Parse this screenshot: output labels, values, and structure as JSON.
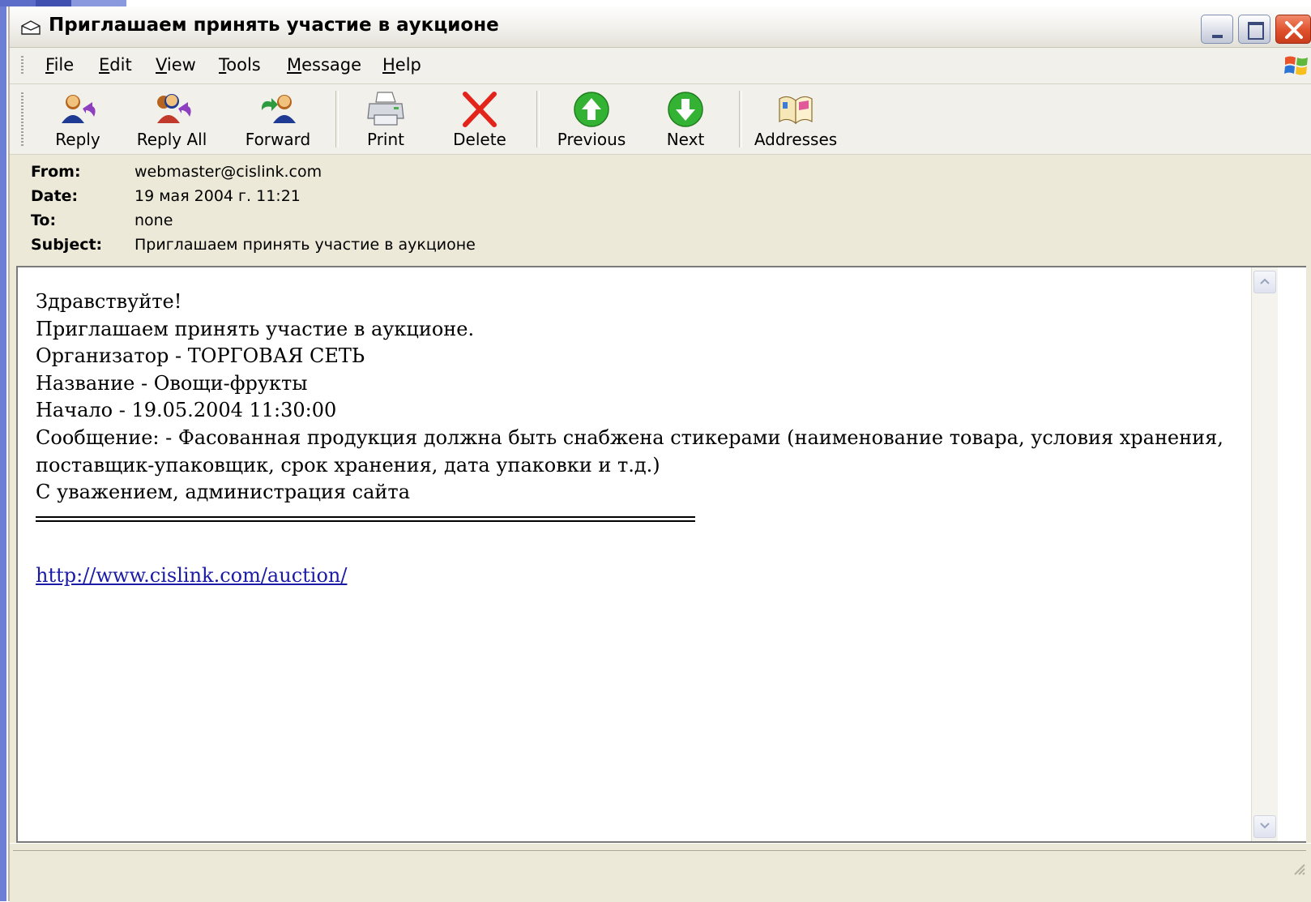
{
  "window": {
    "title": "Приглашаем принять участие в аукционе"
  },
  "menu": {
    "items": [
      {
        "underline": "F",
        "rest": "ile"
      },
      {
        "underline": "E",
        "rest": "dit"
      },
      {
        "underline": "V",
        "rest": "iew"
      },
      {
        "underline": "T",
        "rest": "ools"
      },
      {
        "underline": "M",
        "rest": "essage"
      },
      {
        "underline": "H",
        "rest": "elp"
      }
    ]
  },
  "toolbar": {
    "reply": {
      "label": "Reply",
      "icon": "reply-icon"
    },
    "reply_all": {
      "label": "Reply All",
      "icon": "reply-all-icon"
    },
    "forward": {
      "label": "Forward",
      "icon": "forward-icon"
    },
    "print": {
      "label": "Print",
      "icon": "printer-icon"
    },
    "delete": {
      "label": "Delete",
      "icon": "red-x-icon"
    },
    "previous": {
      "label": "Previous",
      "icon": "green-up-arrow-icon"
    },
    "next": {
      "label": "Next",
      "icon": "green-down-arrow-icon"
    },
    "addresses": {
      "label": "Addresses",
      "icon": "address-book-icon"
    }
  },
  "headers": {
    "from": {
      "key": "From:",
      "value": "webmaster@cislink.com"
    },
    "date": {
      "key": "Date:",
      "value": "19 мая 2004 г. 11:21"
    },
    "to": {
      "key": "To:",
      "value": "none"
    },
    "subject": {
      "key": "Subject:",
      "value": "Приглашаем принять участие в аукционе"
    }
  },
  "message": {
    "lines": [
      "Здравствуйте!",
      "Приглашаем принять участие в аукционе.",
      "Организатор - ТОРГОВАЯ СЕТЬ",
      "Название - Овощи-фрукты",
      "Начало - 19.05.2004 11:30:00",
      "Сообщение: - Фасованная продукция должна быть снабжена стикерами (наименование товара, условия хранения, поставщик-упаковщик, срок хранения, дата упаковки и т.д.)",
      "С уважением, администрация сайта"
    ],
    "link": "http://www.cislink.com/auction/"
  },
  "colors": {
    "window_bg": "#ece9d8",
    "link": "#1a1aa6",
    "close_button": "#e0502c"
  }
}
